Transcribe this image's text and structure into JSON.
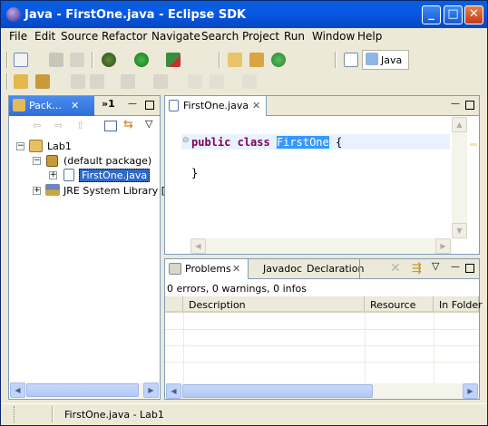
{
  "window": {
    "title": "Java - FirstOne.java - Eclipse SDK"
  },
  "titlebar_buttons": {
    "minimize": "_",
    "maximize": "□",
    "close": "✕"
  },
  "menubar": {
    "items": [
      {
        "label": "File",
        "mnemonic": "F"
      },
      {
        "label": "Edit",
        "mnemonic": "E"
      },
      {
        "label": "Source",
        "mnemonic": "S"
      },
      {
        "label": "Refactor",
        "mnemonic": "t"
      },
      {
        "label": "Navigate",
        "mnemonic": "N"
      },
      {
        "label": "Search",
        "mnemonic": "a"
      },
      {
        "label": "Project",
        "mnemonic": "P"
      },
      {
        "label": "Run",
        "mnemonic": "R"
      },
      {
        "label": "Window",
        "mnemonic": "W"
      },
      {
        "label": "Help",
        "mnemonic": "H"
      }
    ]
  },
  "perspective": {
    "label": "Java"
  },
  "package_explorer": {
    "tab_label": "Pack...",
    "overflow_label": "»1",
    "tree": [
      {
        "label": "Lab1",
        "icon": "project-icon"
      },
      {
        "label": "(default package)",
        "icon": "package-icon"
      },
      {
        "label": "FirstOne.java",
        "icon": "java-file-icon",
        "selected": true
      },
      {
        "label": "JRE System Library [j",
        "icon": "library-icon"
      }
    ]
  },
  "editor": {
    "tab_label": "FirstOne.java",
    "code_lines": [
      {
        "keyword1": "public",
        "keyword2": "class",
        "identifier": "FirstOne",
        "rest": " {"
      },
      {
        "text": "}"
      }
    ]
  },
  "problems_view": {
    "tabs": [
      {
        "label": "Problems",
        "active": true
      },
      {
        "label": "Javadoc",
        "active": false
      },
      {
        "label": "Declaration",
        "active": false
      }
    ],
    "summary": "0 errors, 0 warnings, 0 infos",
    "columns": [
      "Description",
      "Resource",
      "In Folder"
    ]
  },
  "statusbar": {
    "text": "FirstOne.java - Lab1"
  },
  "colors": {
    "title_blue": "#0858e8",
    "active_tab_blue": "#2f6fd8",
    "selection_blue": "#3399ff",
    "keyword": "#7f0055",
    "current_line": "#e8f2fe"
  }
}
